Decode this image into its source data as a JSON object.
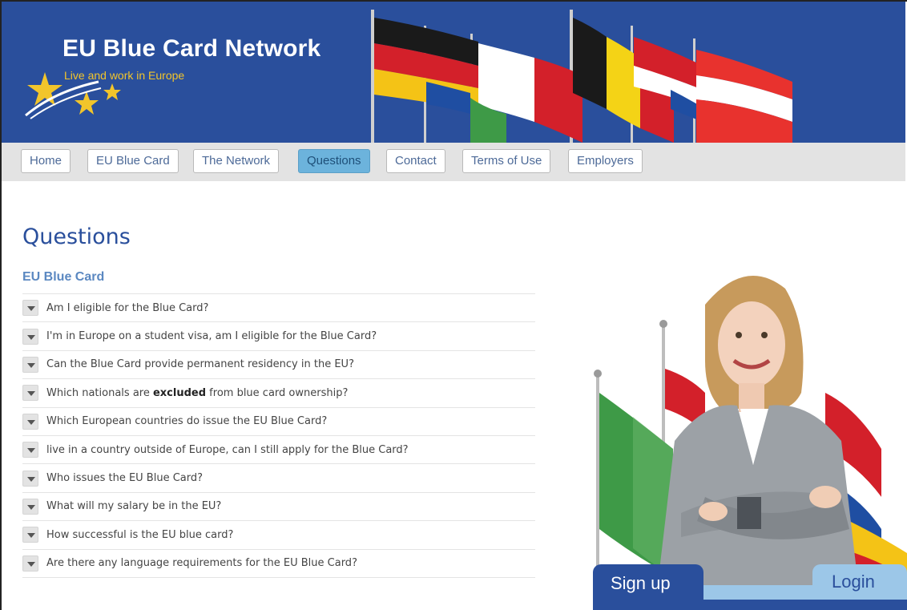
{
  "header": {
    "title": "EU Blue Card Network",
    "tagline": "Live and work in Europe"
  },
  "nav": {
    "items": [
      {
        "label": "Home",
        "active": false
      },
      {
        "label": "EU Blue Card",
        "active": false
      },
      {
        "label": "The Network",
        "active": false
      },
      {
        "label": "Questions",
        "active": true
      },
      {
        "label": "Contact",
        "active": false
      },
      {
        "label": "Terms of Use",
        "active": false
      },
      {
        "label": "Employers",
        "active": false
      }
    ]
  },
  "main": {
    "page_title": "Questions",
    "section_title": "EU Blue Card",
    "faq": [
      {
        "question": "Am I eligible for the Blue Card?"
      },
      {
        "question": "I'm in Europe on a student visa, am I eligible for the Blue Card?"
      },
      {
        "question": "Can the Blue Card provide permanent residency in the EU?"
      },
      {
        "question_pre": "Which nationals are ",
        "question_bold": "excluded",
        "question_post": " from blue card ownership?"
      },
      {
        "question": "Which European countries do issue the EU Blue Card?"
      },
      {
        "question": "live in a country outside of Europe, can I still apply for the Blue Card?"
      },
      {
        "question": "Who issues the EU Blue Card?"
      },
      {
        "question": "What will my salary be in the EU?"
      },
      {
        "question": "How successful is the EU blue card?"
      },
      {
        "question": "Are there any language requirements for the EU Blue Card?"
      }
    ]
  },
  "account_tabs": {
    "signup_label": "Sign up",
    "login_label": "Login"
  },
  "colors": {
    "brand_blue": "#2a4f9c",
    "tagline_yellow": "#f2c52b",
    "nav_active": "#6cb3dc",
    "login_tab": "#9cc7e8"
  }
}
